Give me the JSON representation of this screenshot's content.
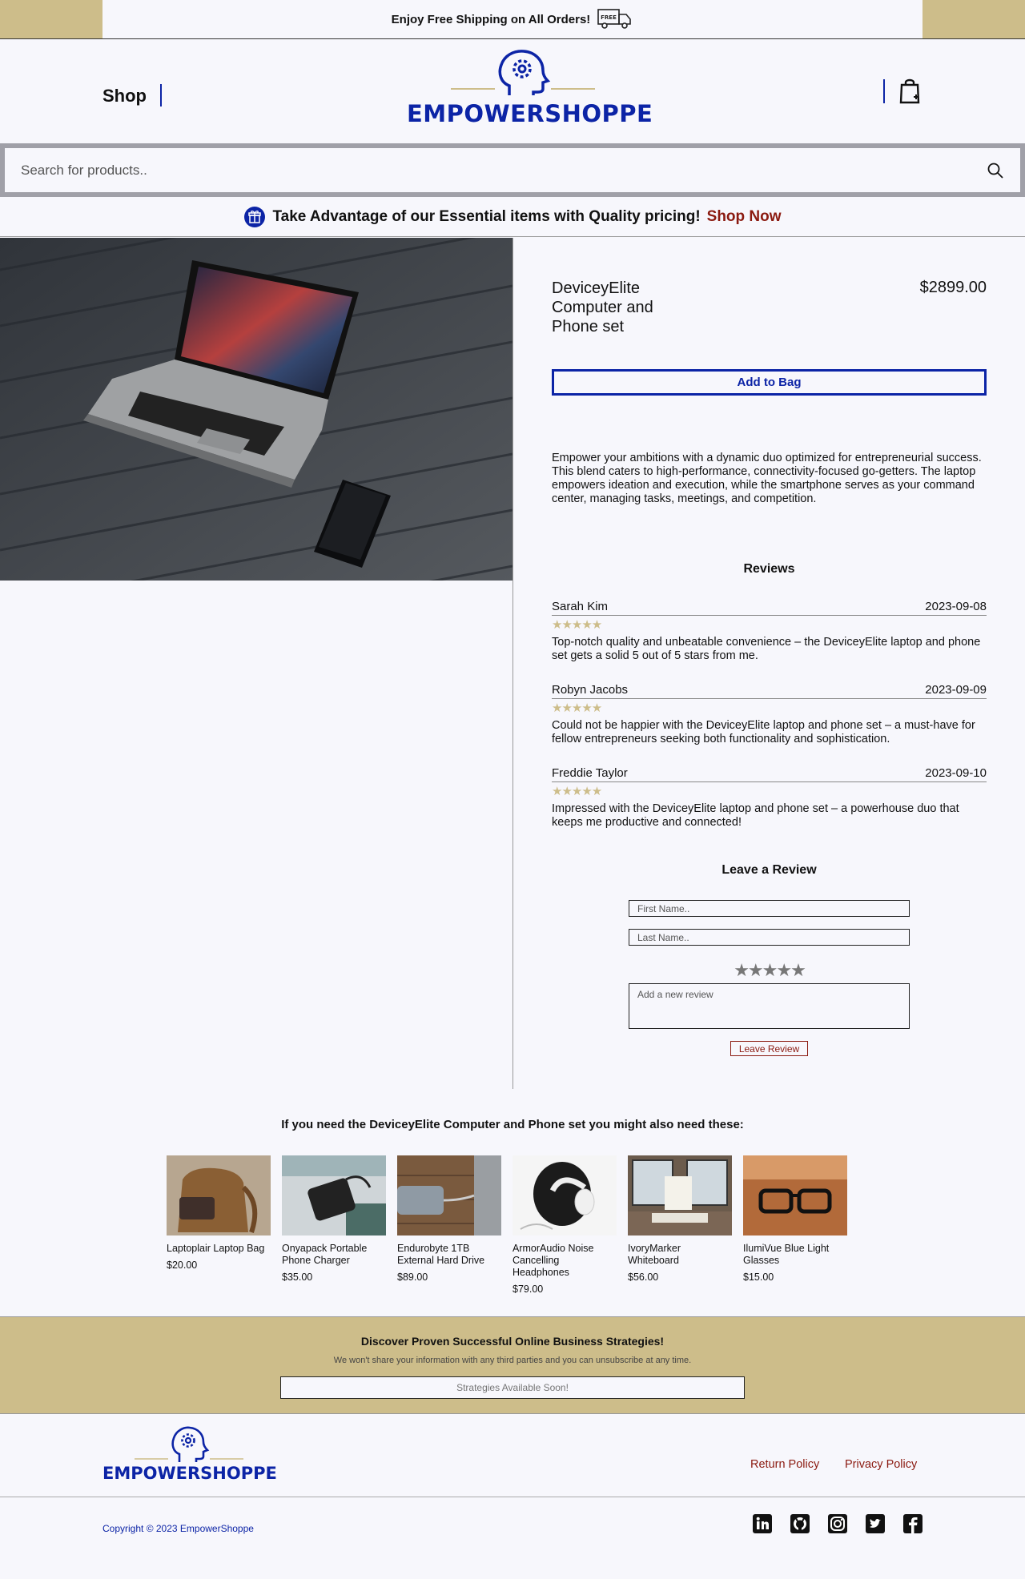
{
  "colors": {
    "accent": "#0c24a6",
    "gold": "#cdbd8a",
    "link_red": "#8b1a10",
    "background": "#f7f7fc"
  },
  "topbar": {
    "text": "Enjoy Free Shipping on All Orders!",
    "icon": "free-delivery-truck-icon"
  },
  "header": {
    "shop_label": "Shop",
    "logo_text": "EMPOWERSHOPPE",
    "cart_icon": "shopping-bag-icon"
  },
  "search": {
    "placeholder": "Search for products..",
    "icon": "search-icon"
  },
  "promo": {
    "text": "Take Advantage of our Essential items with Quality pricing!",
    "link": "Shop Now",
    "icon": "gift-icon"
  },
  "product": {
    "name": "DeviceyElite Computer and Phone set",
    "price": "$2899.00",
    "add_to_bag": "Add to Bag",
    "description": "Empower your ambitions with a dynamic duo optimized for entrepreneurial success. This blend caters to high-performance, connectivity-focused go-getters. The laptop empowers ideation and execution, while the smartphone serves as your command center, managing tasks, meetings, and competition."
  },
  "reviews": {
    "title": "Reviews",
    "items": [
      {
        "name": "Sarah Kim",
        "date": "2023-09-08",
        "stars": "★★★★★",
        "rating": 5,
        "text": "Top-notch quality and unbeatable convenience – the DeviceyElite laptop and phone set gets a solid 5 out of 5 stars from me."
      },
      {
        "name": "Robyn Jacobs",
        "date": "2023-09-09",
        "stars": "★★★★★",
        "rating": 5,
        "text": "Could not be happier with the DeviceyElite laptop and phone set – a must-have for fellow entrepreneurs seeking both functionality and sophistication."
      },
      {
        "name": "Freddie Taylor",
        "date": "2023-09-10",
        "stars": "★★★★★",
        "rating": 5,
        "text": "Impressed with the DeviceyElite laptop and phone set – a powerhouse duo that keeps me productive and connected!"
      }
    ]
  },
  "leave_review": {
    "title": "Leave a Review",
    "first_name_placeholder": "First Name..",
    "last_name_placeholder": "Last Name..",
    "stars": "★★★★★",
    "review_placeholder": "Add a new review",
    "button": "Leave Review"
  },
  "related": {
    "title": "If you need the DeviceyElite Computer and Phone set you might also need these:",
    "items": [
      {
        "name": "Laptoplair Laptop Bag",
        "price": "$20.00"
      },
      {
        "name": "Onyapack Portable Phone Charger",
        "price": "$35.00"
      },
      {
        "name": "Endurobyte 1TB External Hard Drive",
        "price": "$89.00"
      },
      {
        "name": "ArmorAudio Noise Cancelling Headphones",
        "price": "$79.00"
      },
      {
        "name": "IvoryMarker Whiteboard",
        "price": "$56.00"
      },
      {
        "name": "IlumiVue Blue Light Glasses",
        "price": "$15.00"
      }
    ]
  },
  "newsletter": {
    "title": "Discover Proven Successful Online Business Strategies!",
    "subtitle": "We won't share your information with any third parties and you can unsubscribe at any time.",
    "input_placeholder": "Strategies Available Soon!"
  },
  "footer": {
    "logo_text": "EMPOWERSHOPPE",
    "links": [
      "Return Policy",
      "Privacy Policy"
    ],
    "copyright": "Copyright © 2023 EmpowerShoppe",
    "social": [
      "linkedin-icon",
      "github-icon",
      "instagram-icon",
      "twitter-icon",
      "facebook-icon"
    ]
  }
}
